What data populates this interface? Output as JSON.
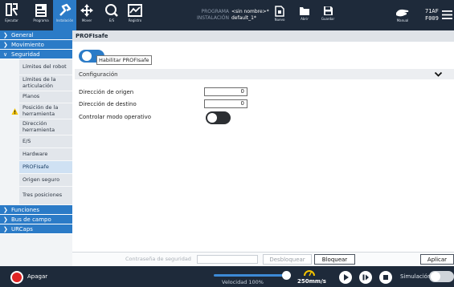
{
  "header": {
    "buttons": [
      {
        "label": "Ejecutar",
        "icon": "robot-logo-icon"
      },
      {
        "label": "Programa",
        "icon": "program-icon"
      },
      {
        "label": "Instalación",
        "icon": "installation-icon"
      },
      {
        "label": "Mover",
        "icon": "move-icon"
      },
      {
        "label": "E/S",
        "icon": "io-icon"
      },
      {
        "label": "Registro",
        "icon": "log-icon"
      }
    ],
    "program_key": "PROGRAMA",
    "program_value": "<sin nombre>*",
    "installation_key": "INSTALACIÓN",
    "installation_value": "default_1*",
    "file_buttons": [
      {
        "label": "Nuevo",
        "icon": "new-file-icon"
      },
      {
        "label": "Abrir",
        "icon": "folder-icon"
      },
      {
        "label": "Guardar",
        "icon": "save-icon"
      }
    ],
    "mode_label": "Manual",
    "status_line1": "71AF",
    "status_line2": "F009"
  },
  "sidebar": {
    "general": "General",
    "movimiento": "Movimiento",
    "seguridad": "Seguridad",
    "seguridad_items": [
      "Límites del robot",
      "Límites de la articulación",
      "Planos",
      "Posición de la herramienta",
      "Dirección herramienta",
      "E/S",
      "Hardware",
      "PROFIsafe",
      "Origen seguro",
      "Tres posiciones"
    ],
    "funciones": "Funciones",
    "bus_de_campo": "Bus de campo",
    "urcaps": "URCaps"
  },
  "main": {
    "title": "PROFIsafe",
    "enable_label": "Habilitar PROFIsafe",
    "config_label": "Configuración",
    "fields": [
      {
        "label": "Dirección de origen",
        "value": "0"
      },
      {
        "label": "Dirección de destino",
        "value": "0"
      }
    ],
    "operating_mode_label": "Controlar modo operativo",
    "password_label": "Contraseña de seguridad",
    "unlock_label": "Desbloquear",
    "lock_label": "Bloquear",
    "apply_label": "Aplicar"
  },
  "footer": {
    "power_label": "Apagar",
    "speed_label": "Velocidad 100%",
    "speed_value": "250mm/s",
    "simulation_label": "Simulación"
  },
  "colors": {
    "topbar": "#1e2a3a",
    "accent": "#2b7bc7",
    "power_red": "#e02424"
  }
}
